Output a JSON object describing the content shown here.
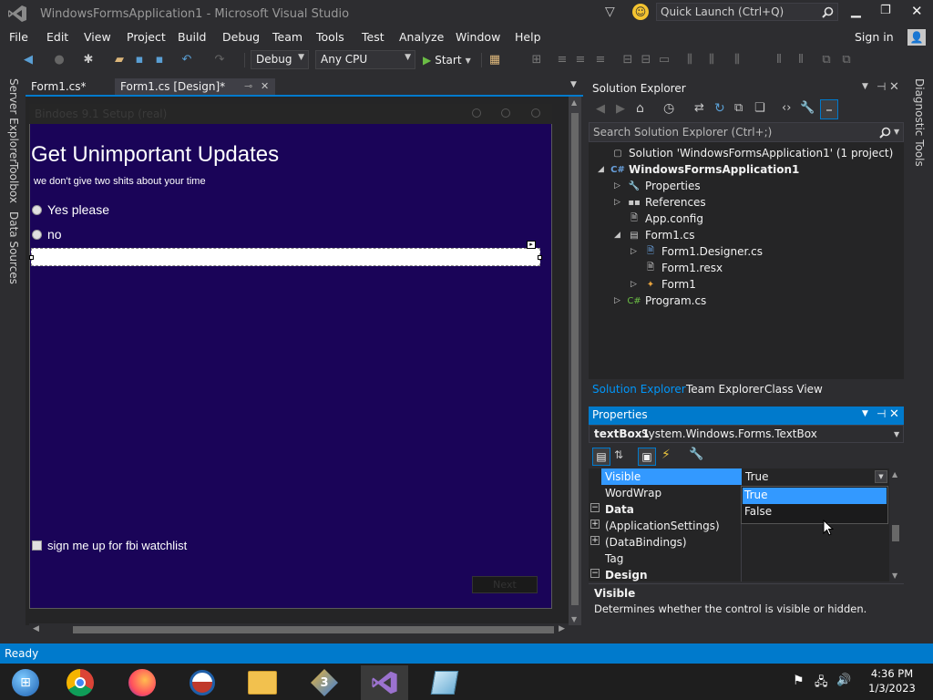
{
  "window": {
    "title": "WindowsFormsApplication1 - Microsoft Visual Studio",
    "quick_launch_placeholder": "Quick Launch (Ctrl+Q)"
  },
  "menu": [
    "File",
    "Edit",
    "View",
    "Project",
    "Build",
    "Debug",
    "Team",
    "Tools",
    "Test",
    "Analyze",
    "Window",
    "Help"
  ],
  "sign_in": "Sign in",
  "toolbar": {
    "config": "Debug",
    "platform": "Any CPU",
    "start": "Start"
  },
  "left_strip": [
    "Server Explorer",
    "Toolbox",
    "Data Sources"
  ],
  "right_strip": "Diagnostic Tools",
  "doc_tabs": [
    "Form1.cs*",
    "Form1.cs [Design]*"
  ],
  "form": {
    "title": "Bindoes 9.1 Setup (real)",
    "heading": "Get Unimportant Updates",
    "subheading": "we don't give two shits about your time",
    "radio1": "Yes please",
    "radio2": "no",
    "checkbox": "sign me up for fbi watchlist",
    "next_button": "Next"
  },
  "solution_explorer": {
    "title": "Solution Explorer",
    "search_placeholder": "Search Solution Explorer (Ctrl+;)",
    "tree": [
      {
        "label": "Solution 'WindowsFormsApplication1' (1 project)",
        "icon": "solution-icon"
      },
      {
        "label": "WindowsFormsApplication1",
        "icon": "csharp-project-icon"
      },
      {
        "label": "Properties",
        "icon": "wrench-icon"
      },
      {
        "label": "References",
        "icon": "references-icon"
      },
      {
        "label": "App.config",
        "icon": "config-file-icon"
      },
      {
        "label": "Form1.cs",
        "icon": "form-icon"
      },
      {
        "label": "Form1.Designer.cs",
        "icon": "cs-file-icon"
      },
      {
        "label": "Form1.resx",
        "icon": "resx-file-icon"
      },
      {
        "label": "Form1",
        "icon": "class-icon"
      },
      {
        "label": "Program.cs",
        "icon": "cs-file-icon"
      }
    ],
    "bottom_tabs": [
      "Solution Explorer",
      "Team Explorer",
      "Class View"
    ]
  },
  "properties": {
    "title": "Properties",
    "object_name": "textBox1",
    "object_type": "System.Windows.Forms.TextBox",
    "rows": [
      {
        "name": "Visible",
        "value": "True"
      },
      {
        "name": "WordWrap",
        "value": ""
      },
      {
        "name": "Data",
        "value": ""
      },
      {
        "name": "(ApplicationSettings)",
        "value": ""
      },
      {
        "name": "(DataBindings)",
        "value": ""
      },
      {
        "name": "Tag",
        "value": ""
      },
      {
        "name": "Design",
        "value": ""
      }
    ],
    "dropdown_options": [
      "True",
      "False"
    ],
    "desc_title": "Visible",
    "desc_text": "Determines whether the control is visible or hidden."
  },
  "status": "Ready",
  "clock": {
    "time": "4:36 PM",
    "date": "1/3/2023"
  },
  "colors": {
    "accent": "#007acc",
    "form_bg": "#1a0458",
    "vs_purple": "#68217a"
  }
}
